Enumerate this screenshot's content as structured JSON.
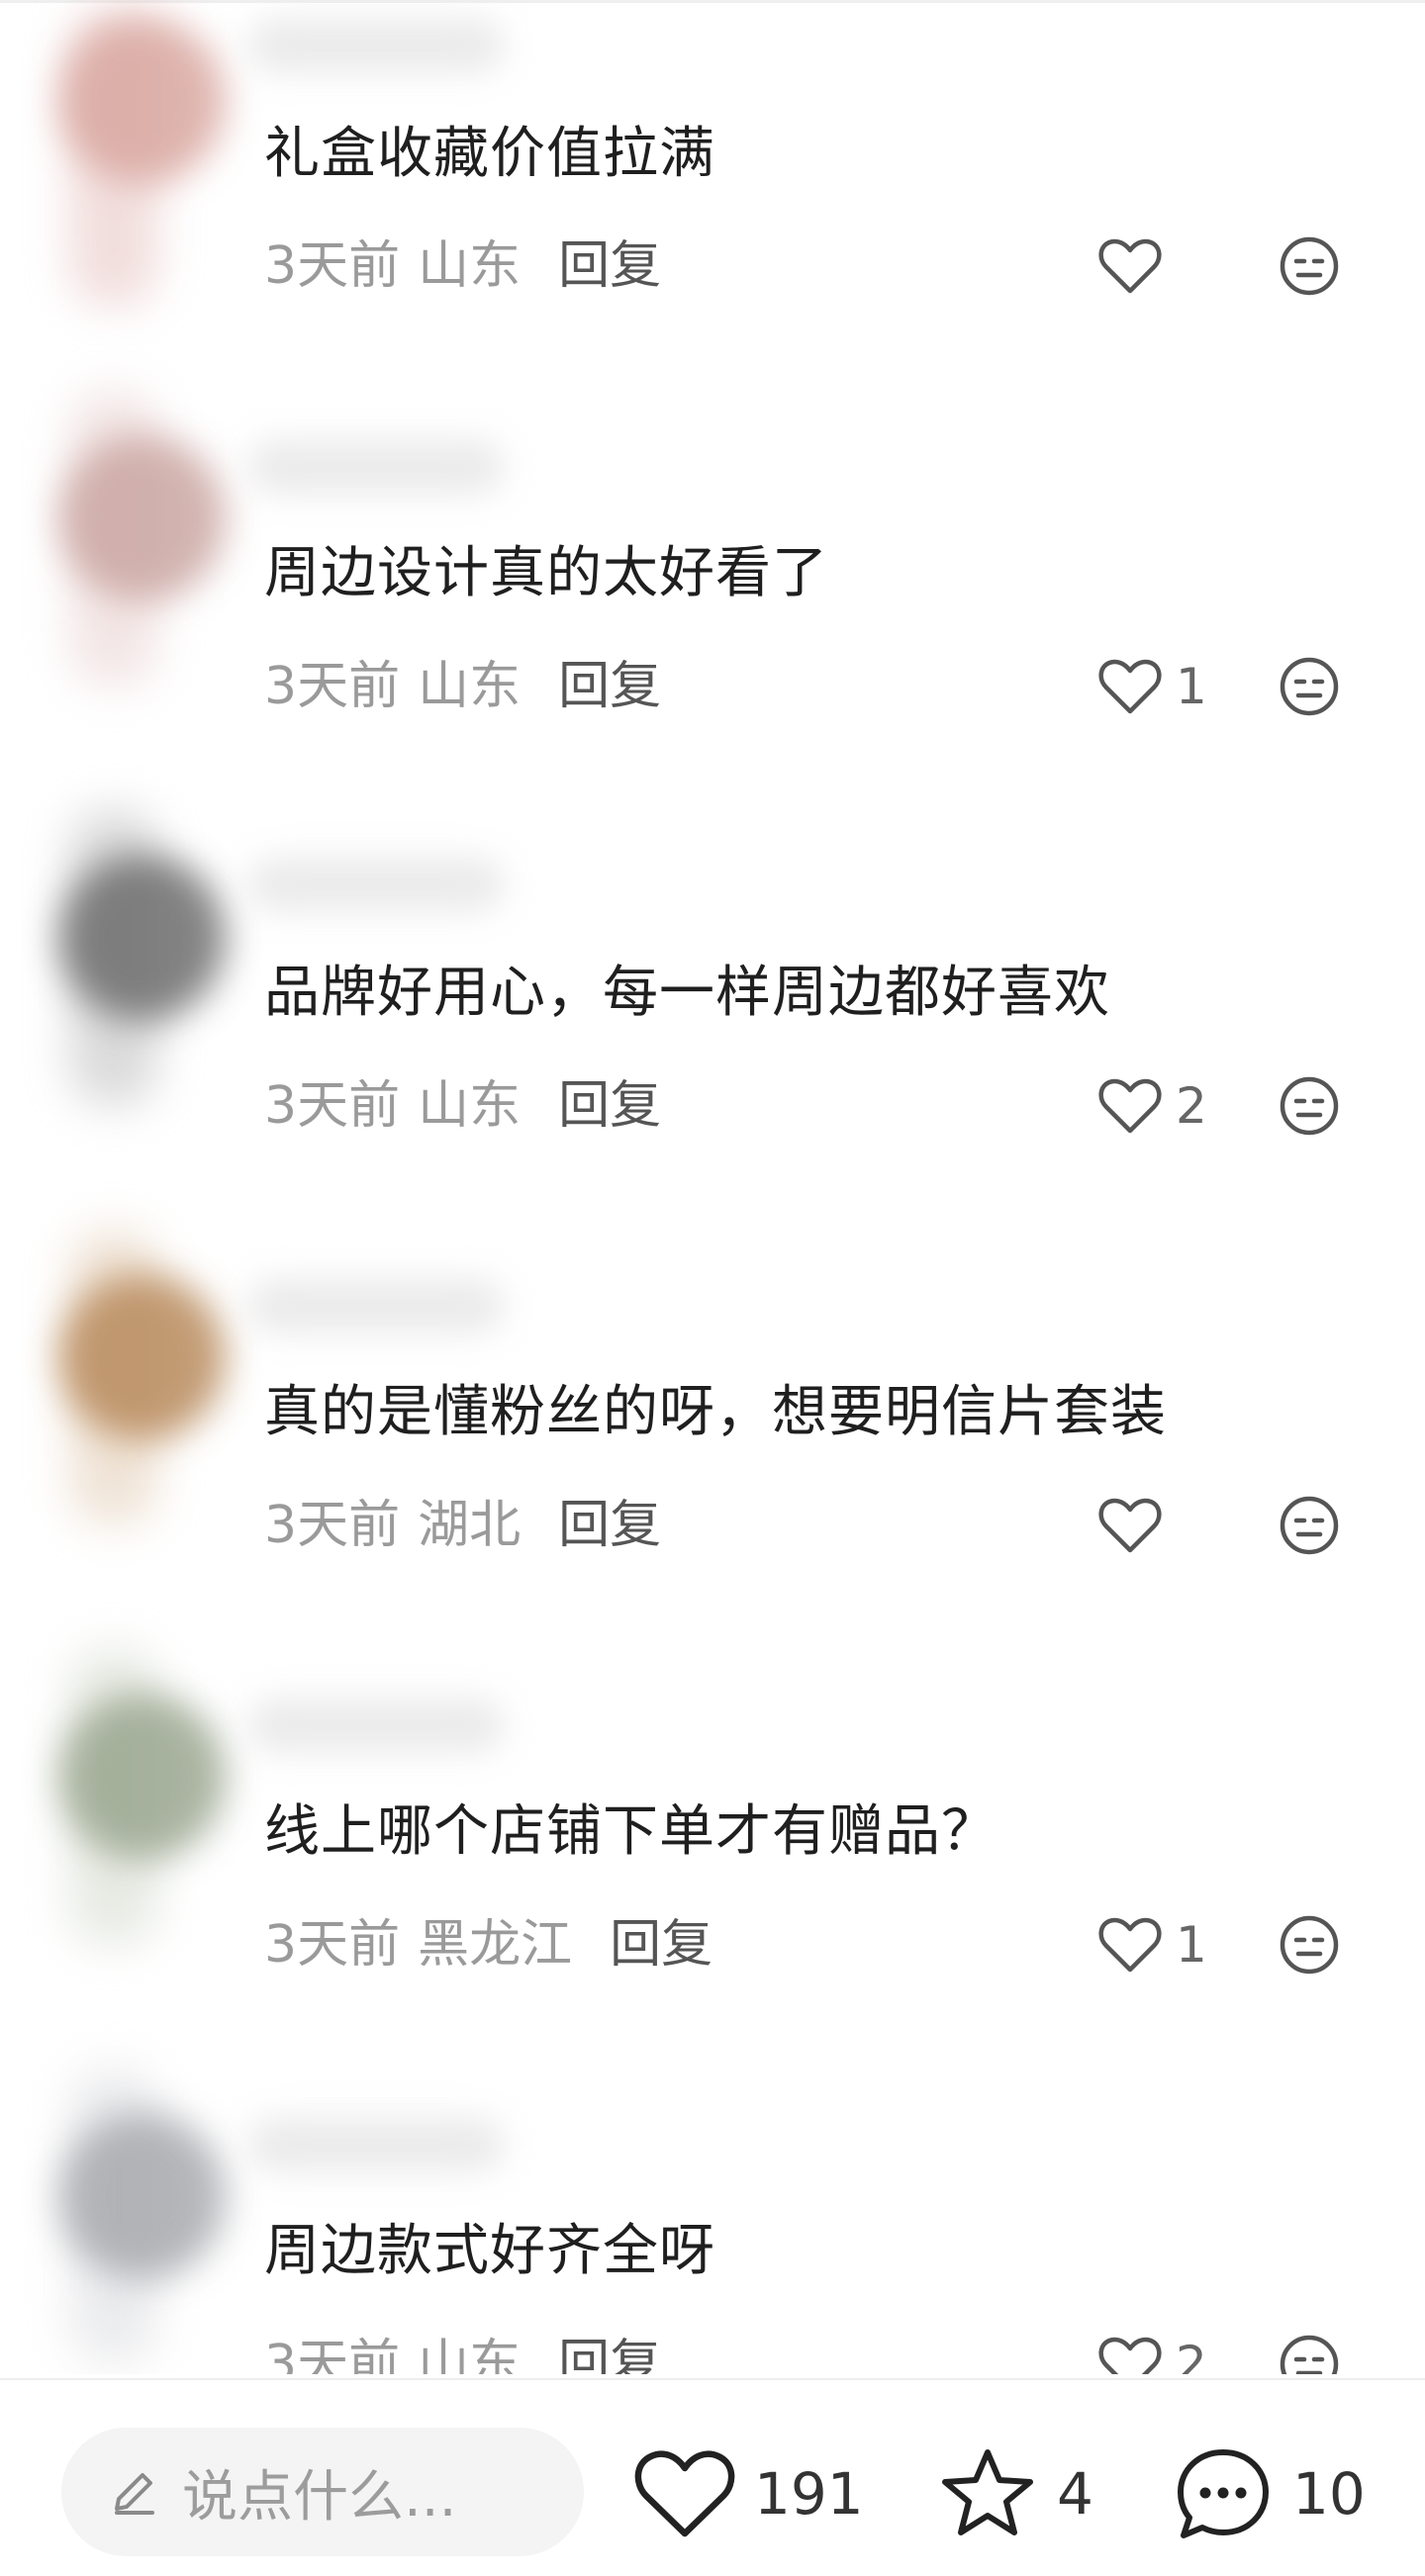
{
  "comments": [
    {
      "text": "礼盒收藏价值拉满",
      "time": "3天前",
      "location": "山东",
      "reply": "回复",
      "likes": "",
      "avatar_color": "#d9a7a0"
    },
    {
      "text": "周边设计真的太好看了",
      "time": "3天前",
      "location": "山东",
      "reply": "回复",
      "likes": "1",
      "avatar_color": "#caa6a2"
    },
    {
      "text": "品牌好用心，每一样周边都好喜欢",
      "time": "3天前",
      "location": "山东",
      "reply": "回复",
      "likes": "2",
      "avatar_color": "#6d6d6d"
    },
    {
      "text": "真的是懂粉丝的呀，想要明信片套装",
      "time": "3天前",
      "location": "湖北",
      "reply": "回复",
      "likes": "",
      "avatar_color": "#b88a5c"
    },
    {
      "text": "线上哪个店铺下单才有赠品？",
      "time": "3天前",
      "location": "黑龙江",
      "reply": "回复",
      "likes": "1",
      "avatar_color": "#9aa68f"
    },
    {
      "text": "周边款式好齐全呀",
      "time": "3天前",
      "location": "山东",
      "reply": "回复",
      "likes": "2",
      "avatar_color": "#a7a9ad"
    }
  ],
  "bottom_bar": {
    "input_placeholder": "说点什么...",
    "like_count": "191",
    "favorite_count": "4",
    "comment_count": "10"
  },
  "icons": {
    "like": "heart-icon",
    "emoji": "meh-face-icon",
    "edit": "pencil-icon",
    "favorite": "star-icon",
    "comment": "chat-bubble-icon"
  }
}
